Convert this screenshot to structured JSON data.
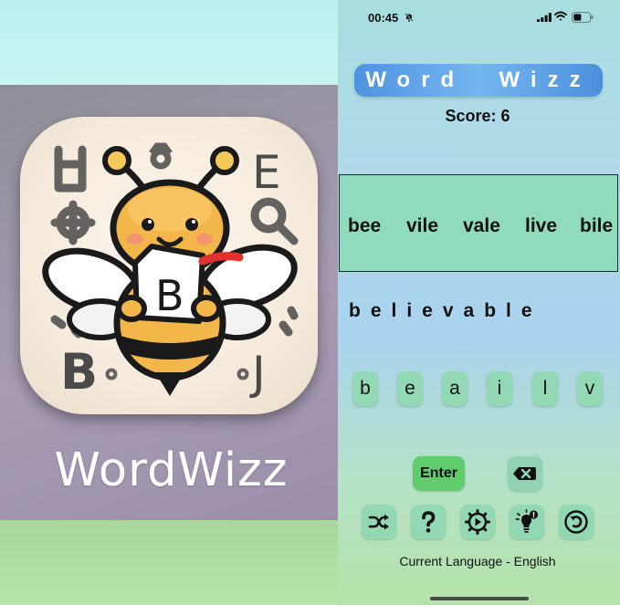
{
  "promo": {
    "title": "WordWizz",
    "icon_letters": [
      "E",
      "B",
      "J",
      "B"
    ],
    "colors": {
      "sky": "#b9f1ef",
      "panel": "#a69bb2",
      "grass": "#a7d99b"
    }
  },
  "status_bar": {
    "time": "00:45",
    "icons": [
      "bell-slash-icon",
      "cellular-signal-icon",
      "wifi-icon",
      "battery-icon"
    ]
  },
  "app": {
    "title": "Word  Wizz",
    "score_text": "Score: 6",
    "found_words": [
      "bee",
      "vile",
      "vale",
      "live",
      "bile"
    ],
    "scrambled_word": "believable",
    "letter_tiles": [
      "b",
      "e",
      "a",
      "i",
      "l",
      "v"
    ],
    "enter_label": "Enter",
    "language_label": "Current Language - English",
    "tools": [
      "shuffle-icon",
      "help-icon",
      "settings-icon",
      "hint-icon",
      "reset-icon"
    ],
    "colors": {
      "banner": "#5a9fe6",
      "words_box": "#8fdbbc",
      "tile": "#93d8b5",
      "enter": "#5fcc6e"
    }
  }
}
